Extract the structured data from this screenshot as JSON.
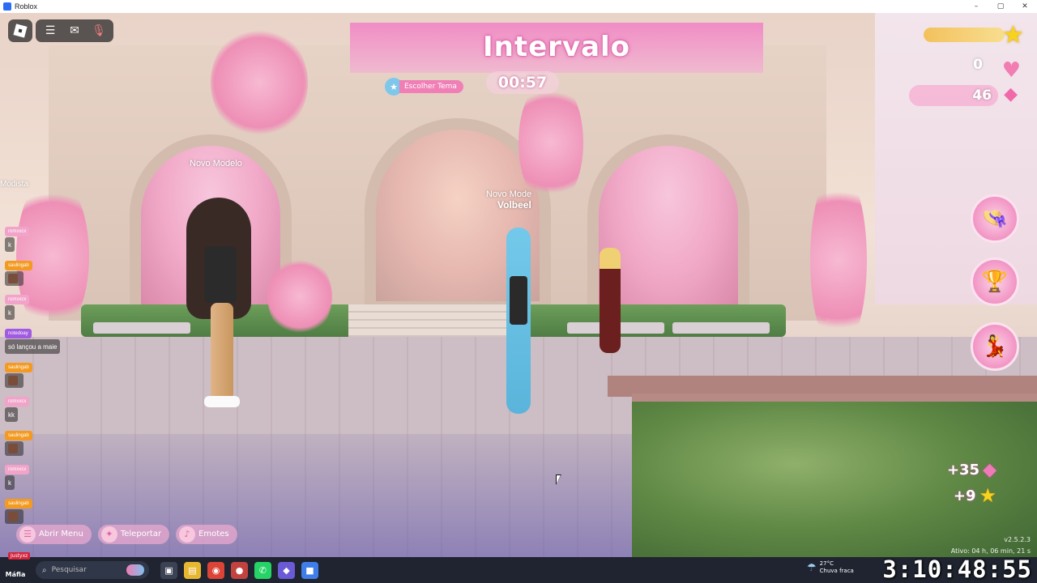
{
  "window": {
    "title": "Roblox",
    "controls": [
      "–",
      "▢",
      "✕"
    ]
  },
  "hud": {
    "menu_icon": "hamburger-icon",
    "chat_icon": "chat-icon",
    "mic_icon": "microphone-icon"
  },
  "round": {
    "phase_title": "Intervalo",
    "timer": "00:57",
    "theme_button": "Escolher Tema"
  },
  "currency": {
    "hearts": "0",
    "gems": "46"
  },
  "nametags": [
    {
      "line1": "Novo Modelo",
      "line2": ""
    },
    {
      "line1": "Novo Mode",
      "line2": "Volbeel"
    }
  ],
  "side_label": "Modista",
  "chat": [
    {
      "name": "romxxcx",
      "name_color": "#f2a3c9",
      "msg": "k",
      "avatar": false
    },
    {
      "name": "saulingab",
      "name_color": "#f29a21",
      "msg": "",
      "avatar": true
    },
    {
      "name": "romxxcx",
      "name_color": "#f2a3c9",
      "msg": "k",
      "avatar": false
    },
    {
      "name": "notedoay",
      "name_color": "#a05be0",
      "msg": "só lançou a maie",
      "avatar": false
    },
    {
      "name": "saulingab",
      "name_color": "#f29a21",
      "msg": "",
      "avatar": true
    },
    {
      "name": "romxxcx",
      "name_color": "#f2a3c9",
      "msg": "kk",
      "avatar": false
    },
    {
      "name": "saulingab",
      "name_color": "#f29a21",
      "msg": "",
      "avatar": true
    },
    {
      "name": "romxxcx",
      "name_color": "#f2a3c9",
      "msg": "k",
      "avatar": false
    },
    {
      "name": "saulingab",
      "name_color": "#f29a21",
      "msg": "",
      "avatar": true
    }
  ],
  "bottom_menu": [
    {
      "label": "Abrir Menu",
      "icon": "☰"
    },
    {
      "label": "Teleportar",
      "icon": "✦"
    },
    {
      "label": "Emotes",
      "icon": "♪"
    }
  ],
  "rewards": [
    {
      "value": "+35",
      "icon": "gem"
    },
    {
      "value": "+9",
      "icon": "star"
    }
  ],
  "version": "v2.5.2.3",
  "uptime": "Ativo: 04 h, 06 min, 21 s",
  "game_clock": "3:10:48:55",
  "taskbar": {
    "badge": "Justyxz",
    "start_label": "Máfia",
    "search_placeholder": "Pesquisar",
    "apps": [
      {
        "name": "task-view-icon",
        "glyph": "▣",
        "color": "#3b4254"
      },
      {
        "name": "file-explorer-icon",
        "glyph": "▤",
        "color": "#e8b730"
      },
      {
        "name": "chrome-icon",
        "glyph": "◉",
        "color": "#db4437"
      },
      {
        "name": "app-red-icon",
        "glyph": "●",
        "color": "#c2423f"
      },
      {
        "name": "whatsapp-icon",
        "glyph": "✆",
        "color": "#25d366"
      },
      {
        "name": "app-purple-icon",
        "glyph": "◆",
        "color": "#6b5ad6"
      },
      {
        "name": "roblox-taskbar-icon",
        "glyph": "■",
        "color": "#3f7ee8"
      }
    ],
    "weather_temp": "27°C",
    "weather_desc": "Chuva fraca"
  }
}
